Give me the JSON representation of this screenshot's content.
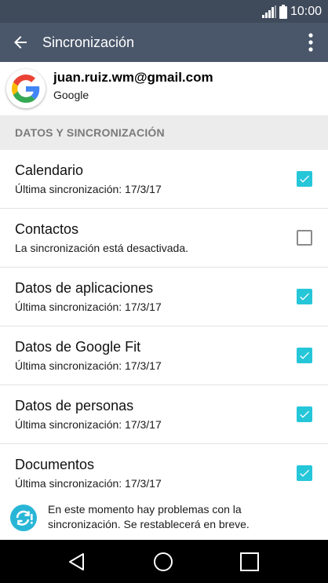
{
  "status_bar": {
    "time": "10:00"
  },
  "app_bar": {
    "title": "Sincronización"
  },
  "account": {
    "email": "juan.ruiz.wm@gmail.com",
    "type": "Google"
  },
  "section": {
    "title": "DATOS Y SINCRONIZACIÓN"
  },
  "sync_items": [
    {
      "title": "Calendario",
      "subtitle": "Última sincronización: 17/3/17",
      "checked": true
    },
    {
      "title": "Contactos",
      "subtitle": "La sincronización está desactivada.",
      "checked": false
    },
    {
      "title": "Datos de aplicaciones",
      "subtitle": "Última sincronización: 17/3/17",
      "checked": true
    },
    {
      "title": "Datos de Google Fit",
      "subtitle": "Última sincronización: 17/3/17",
      "checked": true
    },
    {
      "title": "Datos de personas",
      "subtitle": "Última sincronización: 17/3/17",
      "checked": true
    },
    {
      "title": "Documentos",
      "subtitle": "Última sincronización: 17/3/17",
      "checked": true
    }
  ],
  "notice": {
    "text": "En este momento hay problemas con la sincronización. Se restablecerá en breve."
  },
  "colors": {
    "status_bar": "#3f4a5b",
    "app_bar": "#4a576a",
    "accent": "#26c6d9",
    "section_bg": "#ececec"
  },
  "icons": {
    "back": "arrow-left-icon",
    "menu": "more-vert-icon",
    "signal": "signal-icon",
    "battery": "battery-icon",
    "account": "google-logo-icon",
    "notice": "sync-problem-icon",
    "nav_back": "nav-back-triangle-icon",
    "nav_home": "nav-home-circle-icon",
    "nav_recents": "nav-recents-square-icon"
  }
}
